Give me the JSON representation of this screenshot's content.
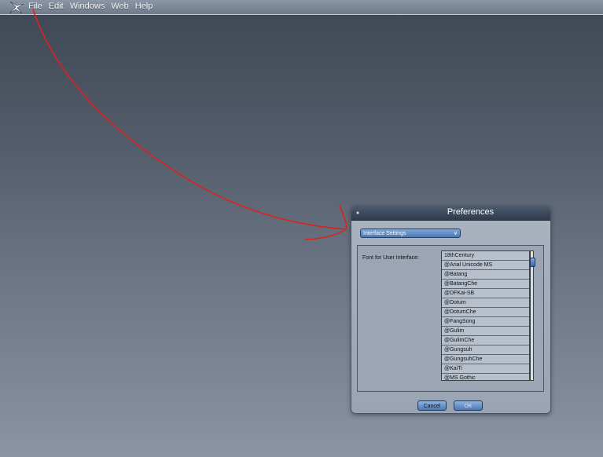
{
  "menubar": {
    "items": [
      "File",
      "Edit",
      "Windows",
      "Web",
      "Help"
    ]
  },
  "icons": {
    "app_logo": "app-logo-icon",
    "close": "close-icon",
    "chevron": "chevron-down-icon"
  },
  "colors": {
    "annotation_arrow": "#e0201b",
    "titlebar": "#2f3b4c",
    "accent": "#4d79b4"
  },
  "dialog": {
    "title": "Preferences",
    "category": "Interface Settings",
    "font_label": "Font for User Interface:",
    "fonts": [
      "18thCentury",
      "@Arial Unicode MS",
      "@Batang",
      "@BatangChe",
      "@DFKai-SB",
      "@Dotum",
      "@DotumChe",
      "@FangSong",
      "@Gulim",
      "@GulimChe",
      "@Gungsuh",
      "@GungsuhChe",
      "@KaiTi",
      "@MS Gothic"
    ],
    "cancel_label": "Cancel",
    "ok_label": "OK"
  }
}
